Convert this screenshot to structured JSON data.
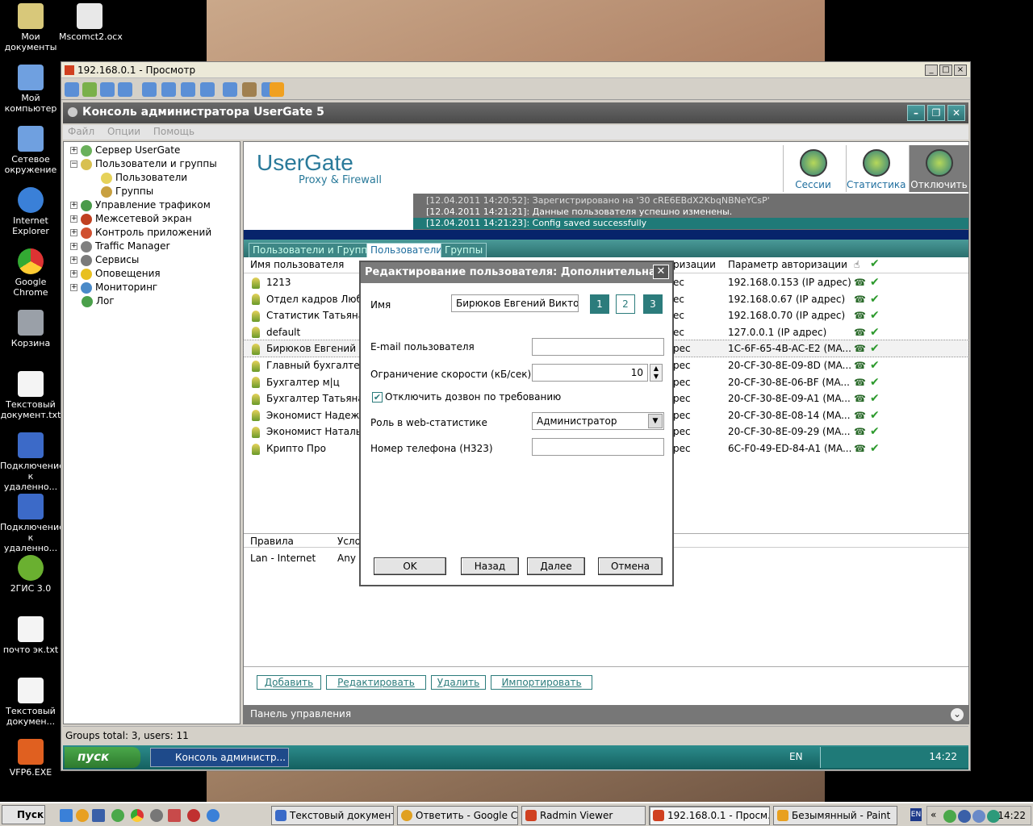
{
  "desktop": {
    "icons": [
      {
        "label": "Мои документы",
        "color": "#d8c87a"
      },
      {
        "label": "Mscomct2.ocx",
        "color": "#e8e8e8"
      },
      {
        "label": "Мой компьютер",
        "color": "#6fa0e0"
      },
      {
        "label": "Сетевое окружение",
        "color": "#6fa0e0"
      },
      {
        "label": "Internet Explorer",
        "color": "#3a80d8"
      },
      {
        "label": "Google Chrome",
        "color": "#e0a020"
      },
      {
        "label": "Корзина",
        "color": "#9aa0a8"
      },
      {
        "label": "Текстовый документ.txt",
        "color": "#f4f4f4"
      },
      {
        "label": "Подключение к удаленно...",
        "color": "#3c6ac8"
      },
      {
        "label": "Подключение к удаленно...",
        "color": "#3c6ac8"
      },
      {
        "label": "2ГИС 3.0",
        "color": "#6ab030"
      },
      {
        "label": "почто эк.txt",
        "color": "#f4f4f4"
      },
      {
        "label": "Текстовый докумен...",
        "color": "#f4f4f4"
      },
      {
        "label": "VFP6.EXE",
        "color": "#e06020"
      }
    ]
  },
  "radmin": {
    "title": "192.168.0.1 - Просмотр"
  },
  "usergate": {
    "title": "Консоль администратора UserGate 5",
    "menu": [
      "Файл",
      "Опции",
      "Помощь"
    ],
    "logo": "UserGate",
    "logo_sub": "Proxy & Firewall",
    "top_buttons": [
      "Сессии",
      "Статистика",
      "Отключить"
    ],
    "log": [
      "[12.04.2011 14:20:52]: Зарегистрировано на '30 cRE6EBdX2KbqNBNeYCsP'",
      "[12.04.2011 14:21:21]: Данные пользователя успешно изменены.",
      "[12.04.2011 14:21:23]: Config saved successfully"
    ],
    "tree": [
      "Сервер UserGate",
      "Пользователи и группы",
      "Пользователи",
      "Группы",
      "Управление трафиком",
      "Межсетевой экран",
      "Контроль приложений",
      "Traffic Manager",
      "Сервисы",
      "Оповещения",
      "Мониторинг",
      "Лог"
    ],
    "tabs": [
      "Пользователи и Группы",
      "Пользователи",
      "Группы"
    ],
    "columns": {
      "name": "Имя пользователя",
      "auth": "ризации",
      "param": "Параметр авторизации"
    },
    "rows": [
      {
        "name": "1213",
        "auth": "ес",
        "param": "192.168.0.153 (IP адрес)"
      },
      {
        "name": "Отдел кадров Любс",
        "auth": "ес",
        "param": "192.168.0.67 (IP адрес)"
      },
      {
        "name": "Статистик Татьяна",
        "auth": "ес",
        "param": "192.168.0.70 (IP адрес)"
      },
      {
        "name": "default",
        "auth": "ес",
        "param": "127.0.0.1 (IP адрес)"
      },
      {
        "name": "Бирюков Евгений Ви",
        "auth": "рес",
        "param": "1C-6F-65-4B-AC-E2 (MA..."
      },
      {
        "name": "Главный бухгалтер",
        "auth": "рес",
        "param": "20-CF-30-8E-09-8D (MA..."
      },
      {
        "name": "Бухгалтер м|ц",
        "auth": "рес",
        "param": "20-CF-30-8E-06-BF (MA..."
      },
      {
        "name": "Бухгалтер Татьяна",
        "auth": "рес",
        "param": "20-CF-30-8E-09-A1 (MA..."
      },
      {
        "name": "Экономист Надежда",
        "auth": "рес",
        "param": "20-CF-30-8E-08-14 (MA..."
      },
      {
        "name": "Экономист Наталья",
        "auth": "рес",
        "param": "20-CF-30-8E-09-29 (MA..."
      },
      {
        "name": "Крипто Про",
        "auth": "рес",
        "param": "6C-F0-49-ED-84-A1 (MA..."
      }
    ],
    "rules": {
      "h1": "Правила",
      "h2": "Усло",
      "r1": "Lan - Internet",
      "r2": "Any"
    },
    "actions": [
      "Добавить",
      "Редактировать",
      "Удалить",
      "Импортировать"
    ],
    "panel": "Панель управления",
    "status": "Groups total: 3, users: 11",
    "start": "пуск",
    "task": "Консоль администр...",
    "lang": "EN",
    "clock": "14:22"
  },
  "dialog": {
    "title": "Редактирование пользователя: Дополнительна...",
    "name_label": "Имя",
    "name_value": "Бирюков Евгений Викторо",
    "steps": [
      "1",
      "2",
      "3"
    ],
    "email_label": "E-mail пользователя",
    "email_value": "",
    "speed_label": "Ограничение скорости (кБ/сек)",
    "speed_value": "10",
    "dial_label": "Отключить дозвон по требованию",
    "role_label": "Роль в web-статистике",
    "role_value": "Администратор",
    "phone_label": "Номер телефона (H323)",
    "phone_value": "",
    "ok": "OK",
    "back": "Назад",
    "next": "Далее",
    "cancel": "Отмена"
  },
  "taskbar": {
    "start": "Пуск",
    "items": [
      "Текстовый документ ...",
      "Ответить - Google Ch...",
      "Radmin Viewer",
      "192.168.0.1 - Просм...",
      "Безымянный - Paint"
    ],
    "lang": "EN",
    "clock": "14:22"
  }
}
